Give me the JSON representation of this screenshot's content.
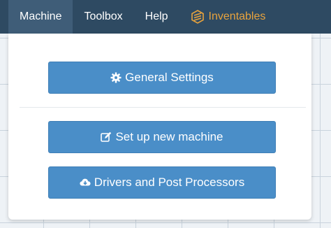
{
  "nav": {
    "items": [
      {
        "label": "Machine"
      },
      {
        "label": "Toolbox"
      },
      {
        "label": "Help"
      }
    ],
    "brand": {
      "label": "Inventables",
      "color": "#e8a33d",
      "icon": "inventables-logo-icon"
    }
  },
  "dropdown": {
    "general_settings": {
      "label": "General Settings",
      "icon": "gear-icon"
    },
    "setup_machine": {
      "label": "Set up new machine",
      "icon": "edit-icon"
    },
    "drivers": {
      "label": "Drivers and Post Processors",
      "icon": "cloud-download-icon"
    }
  },
  "colors": {
    "topbar": "#2e4a62",
    "button": "#4a8ec8"
  }
}
